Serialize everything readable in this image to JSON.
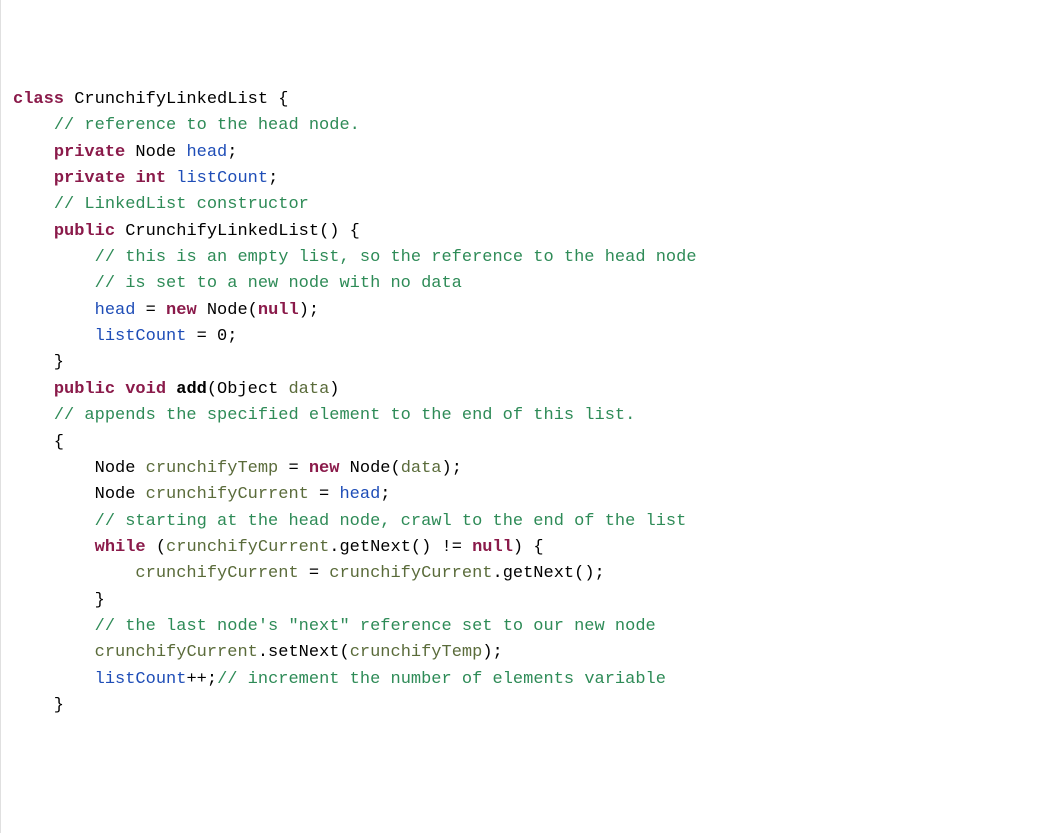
{
  "code": {
    "lines": [
      [
        {
          "cls": "tok-keyword",
          "t": "class"
        },
        {
          "cls": "tok-plain",
          "t": " CrunchifyLinkedList {"
        }
      ],
      [
        {
          "cls": "tok-plain",
          "t": "    "
        },
        {
          "cls": "tok-comment",
          "t": "// reference to the head node."
        }
      ],
      [
        {
          "cls": "tok-plain",
          "t": "    "
        },
        {
          "cls": "tok-keyword",
          "t": "private"
        },
        {
          "cls": "tok-plain",
          "t": " Node "
        },
        {
          "cls": "tok-field",
          "t": "head"
        },
        {
          "cls": "tok-plain",
          "t": ";"
        }
      ],
      [
        {
          "cls": "tok-plain",
          "t": "    "
        },
        {
          "cls": "tok-keyword",
          "t": "private"
        },
        {
          "cls": "tok-plain",
          "t": " "
        },
        {
          "cls": "tok-keyword",
          "t": "int"
        },
        {
          "cls": "tok-plain",
          "t": " "
        },
        {
          "cls": "tok-field",
          "t": "listCount"
        },
        {
          "cls": "tok-plain",
          "t": ";"
        }
      ],
      [
        {
          "cls": "tok-plain",
          "t": ""
        }
      ],
      [
        {
          "cls": "tok-plain",
          "t": "    "
        },
        {
          "cls": "tok-comment",
          "t": "// LinkedList constructor"
        }
      ],
      [
        {
          "cls": "tok-plain",
          "t": "    "
        },
        {
          "cls": "tok-keyword",
          "t": "public"
        },
        {
          "cls": "tok-plain",
          "t": " CrunchifyLinkedList() {"
        }
      ],
      [
        {
          "cls": "tok-plain",
          "t": "        "
        },
        {
          "cls": "tok-comment",
          "t": "// this is an empty list, so the reference to the head node"
        }
      ],
      [
        {
          "cls": "tok-plain",
          "t": "        "
        },
        {
          "cls": "tok-comment",
          "t": "// is set to a new node with no data"
        }
      ],
      [
        {
          "cls": "tok-plain",
          "t": "        "
        },
        {
          "cls": "tok-field",
          "t": "head"
        },
        {
          "cls": "tok-plain",
          "t": " = "
        },
        {
          "cls": "tok-keyword",
          "t": "new"
        },
        {
          "cls": "tok-plain",
          "t": " Node("
        },
        {
          "cls": "tok-null",
          "t": "null"
        },
        {
          "cls": "tok-plain",
          "t": ");"
        }
      ],
      [
        {
          "cls": "tok-plain",
          "t": "        "
        },
        {
          "cls": "tok-field",
          "t": "listCount"
        },
        {
          "cls": "tok-plain",
          "t": " = 0;"
        }
      ],
      [
        {
          "cls": "tok-plain",
          "t": "    }"
        }
      ],
      [
        {
          "cls": "tok-plain",
          "t": ""
        }
      ],
      [
        {
          "cls": "tok-plain",
          "t": "    "
        },
        {
          "cls": "tok-keyword",
          "t": "public"
        },
        {
          "cls": "tok-plain",
          "t": " "
        },
        {
          "cls": "tok-keyword",
          "t": "void"
        },
        {
          "cls": "tok-plain",
          "t": " "
        },
        {
          "cls": "tok-method",
          "t": "add"
        },
        {
          "cls": "tok-plain",
          "t": "(Object "
        },
        {
          "cls": "tok-param",
          "t": "data"
        },
        {
          "cls": "tok-plain",
          "t": ")"
        }
      ],
      [
        {
          "cls": "tok-plain",
          "t": "    "
        },
        {
          "cls": "tok-comment",
          "t": "// appends the specified element to the end of this list."
        }
      ],
      [
        {
          "cls": "tok-plain",
          "t": "    {"
        }
      ],
      [
        {
          "cls": "tok-plain",
          "t": "        Node "
        },
        {
          "cls": "tok-param",
          "t": "crunchifyTemp"
        },
        {
          "cls": "tok-plain",
          "t": " = "
        },
        {
          "cls": "tok-keyword",
          "t": "new"
        },
        {
          "cls": "tok-plain",
          "t": " Node("
        },
        {
          "cls": "tok-param",
          "t": "data"
        },
        {
          "cls": "tok-plain",
          "t": ");"
        }
      ],
      [
        {
          "cls": "tok-plain",
          "t": "        Node "
        },
        {
          "cls": "tok-param",
          "t": "crunchifyCurrent"
        },
        {
          "cls": "tok-plain",
          "t": " = "
        },
        {
          "cls": "tok-field",
          "t": "head"
        },
        {
          "cls": "tok-plain",
          "t": ";"
        }
      ],
      [
        {
          "cls": "tok-plain",
          "t": "        "
        },
        {
          "cls": "tok-comment",
          "t": "// starting at the head node, crawl to the end of the list"
        }
      ],
      [
        {
          "cls": "tok-plain",
          "t": "        "
        },
        {
          "cls": "tok-keyword",
          "t": "while"
        },
        {
          "cls": "tok-plain",
          "t": " ("
        },
        {
          "cls": "tok-param",
          "t": "crunchifyCurrent"
        },
        {
          "cls": "tok-plain",
          "t": ".getNext() != "
        },
        {
          "cls": "tok-null",
          "t": "null"
        },
        {
          "cls": "tok-plain",
          "t": ") {"
        }
      ],
      [
        {
          "cls": "tok-plain",
          "t": "            "
        },
        {
          "cls": "tok-param",
          "t": "crunchifyCurrent"
        },
        {
          "cls": "tok-plain",
          "t": " = "
        },
        {
          "cls": "tok-param",
          "t": "crunchifyCurrent"
        },
        {
          "cls": "tok-plain",
          "t": ".getNext();"
        }
      ],
      [
        {
          "cls": "tok-plain",
          "t": "        }"
        }
      ],
      [
        {
          "cls": "tok-plain",
          "t": "        "
        },
        {
          "cls": "tok-comment",
          "t": "// the last node's \"next\" reference set to our new node"
        }
      ],
      [
        {
          "cls": "tok-plain",
          "t": "        "
        },
        {
          "cls": "tok-param",
          "t": "crunchifyCurrent"
        },
        {
          "cls": "tok-plain",
          "t": ".setNext("
        },
        {
          "cls": "tok-param",
          "t": "crunchifyTemp"
        },
        {
          "cls": "tok-plain",
          "t": ");"
        }
      ],
      [
        {
          "cls": "tok-plain",
          "t": "        "
        },
        {
          "cls": "tok-field",
          "t": "listCount"
        },
        {
          "cls": "tok-plain",
          "t": "++;"
        },
        {
          "cls": "tok-comment",
          "t": "// increment the number of elements variable"
        }
      ],
      [
        {
          "cls": "tok-plain",
          "t": "    }"
        }
      ]
    ]
  }
}
